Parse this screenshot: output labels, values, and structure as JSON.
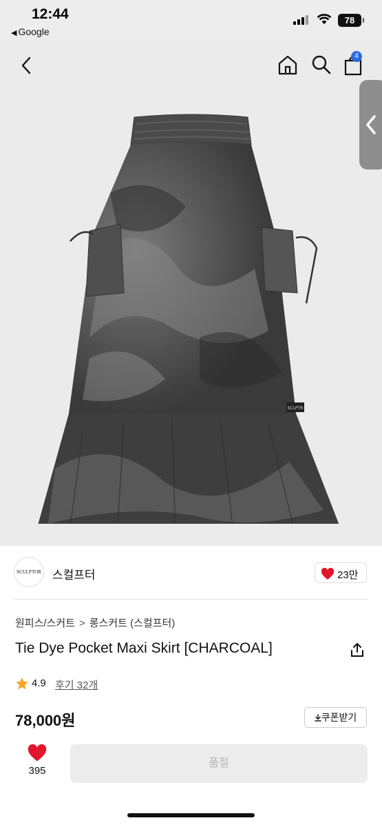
{
  "status_bar": {
    "time": "12:44",
    "back_app": "Google",
    "battery": "78"
  },
  "nav": {
    "cart_count": "4"
  },
  "product_image": {
    "brand_patch_text": "SCLPTR"
  },
  "brand": {
    "logo_text": "SCULPTOR",
    "name": "스컬프터",
    "likes": "23만"
  },
  "breadcrumb": {
    "category": "원피스/스커트",
    "separator": ">",
    "subcategory": "롱스커트 (스컬프터)"
  },
  "product": {
    "title": "Tie Dye Pocket Maxi Skirt [CHARCOAL]",
    "rating": "4.9",
    "reviews": "후기 32개",
    "price": "78,000원"
  },
  "coupon": {
    "label": "쿠폰받기"
  },
  "bottom_bar": {
    "likes": "395",
    "button_label": "품절"
  },
  "colors": {
    "heart": "#e0152b",
    "star": "#f5a623",
    "badge": "#2d6cdf",
    "disabled_bg": "#ececec",
    "disabled_text": "#b5b5b5"
  }
}
